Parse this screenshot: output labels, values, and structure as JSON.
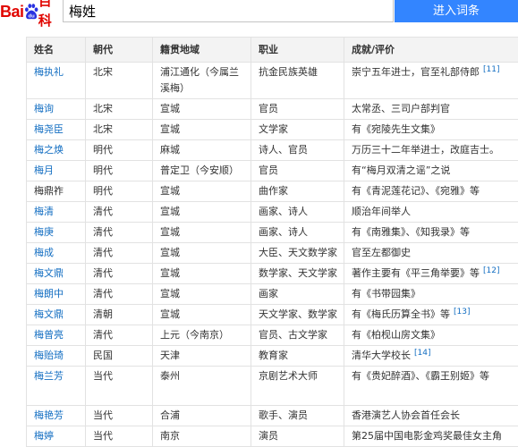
{
  "header": {
    "logo_text_left": "Bai",
    "logo_paw_text": "du",
    "logo_text_right": "百科",
    "logo_icon": "baidu-paw-icon",
    "search_value": "梅姓",
    "enter_button_label": "进入词条"
  },
  "colors": {
    "brand_red": "#e10601",
    "brand_blue": "#2932e1",
    "button": "#3385ff",
    "link": "#136ec2"
  },
  "table": {
    "columns": [
      "姓名",
      "朝代",
      "籍贯地域",
      "职业",
      "成就/评价"
    ],
    "rows": [
      {
        "name": "梅执礼",
        "link": true,
        "dynasty": "北宋",
        "origin": "浦江通化（今属兰溪梅）",
        "occupation": "抗金民族英雄",
        "achievement": "崇宁五年进士，官至礼部侍郎",
        "ref": "[11]"
      },
      {
        "name": "梅询",
        "link": true,
        "dynasty": "北宋",
        "origin": "宣城",
        "occupation": "官员",
        "achievement": "太常丞、三司户部判官"
      },
      {
        "name": "梅尧臣",
        "link": true,
        "dynasty": "北宋",
        "origin": "宣城",
        "occupation": "文学家",
        "achievement": "有《宛陵先生文集》"
      },
      {
        "name": "梅之焕",
        "link": true,
        "dynasty": "明代",
        "origin": "麻城",
        "occupation": "诗人、官员",
        "achievement": "万历三十二年举进士，改庭吉士。"
      },
      {
        "name": "梅月",
        "link": true,
        "dynasty": "明代",
        "origin": "普定卫（今安顺）",
        "occupation": "官员",
        "achievement": "有“梅月双清之谣”之说"
      },
      {
        "name": "梅鼎祚",
        "link": false,
        "dynasty": "明代",
        "origin": "宣城",
        "occupation": "曲作家",
        "achievement": "有《青泥莲花记》、《宛雅》等"
      },
      {
        "name": "梅清",
        "link": true,
        "dynasty": "清代",
        "origin": "宣城",
        "occupation": "画家、诗人",
        "achievement": "顺治年间举人"
      },
      {
        "name": "梅庚",
        "link": true,
        "dynasty": "清代",
        "origin": "宣城",
        "occupation": "画家、诗人",
        "achievement": "有《南雅集》、《知我录》等"
      },
      {
        "name": "梅成",
        "link": true,
        "dynasty": "清代",
        "origin": "宣城",
        "occupation": "大臣、天文数学家",
        "achievement": "官至左都御史"
      },
      {
        "name": "梅文鼎",
        "link": true,
        "dynasty": "清代",
        "origin": "宣城",
        "occupation": "数学家、天文学家",
        "achievement": "著作主要有《平三角举要》等",
        "ref": "[12]"
      },
      {
        "name": "梅朗中",
        "link": true,
        "dynasty": "清代",
        "origin": "宣城",
        "occupation": "画家",
        "achievement": "有《书带园集》"
      },
      {
        "name": "梅文鼎",
        "link": true,
        "dynasty": "清朝",
        "origin": "宣城",
        "occupation": "天文学家、数学家",
        "achievement": "有《梅氏历算全书》等",
        "ref": "[13]"
      },
      {
        "name": "梅曾亮",
        "link": true,
        "dynasty": "清代",
        "origin": "上元（今南京）",
        "occupation": "官员、古文学家",
        "achievement": "有《柏枧山房文集》"
      },
      {
        "name": "梅贻琦",
        "link": true,
        "dynasty": "民国",
        "origin": "天津",
        "occupation": "教育家",
        "achievement": "清华大学校长",
        "ref": "[14]"
      },
      {
        "name": "梅兰芳",
        "link": true,
        "dynasty": "当代",
        "origin": "泰州",
        "occupation": "京剧艺术大师",
        "achievement": "有《贵妃醉酒》、《霸王别姬》等"
      },
      {
        "name": "梅艳芳",
        "link": true,
        "dynasty": "当代",
        "origin": "合浦",
        "occupation": "歌手、演员",
        "achievement": "香港演艺人协会首任会长"
      },
      {
        "name": "梅婷",
        "link": true,
        "dynasty": "当代",
        "origin": "南京",
        "occupation": "演员",
        "achievement": "第25届中国电影金鸡奖最佳女主角"
      }
    ]
  }
}
